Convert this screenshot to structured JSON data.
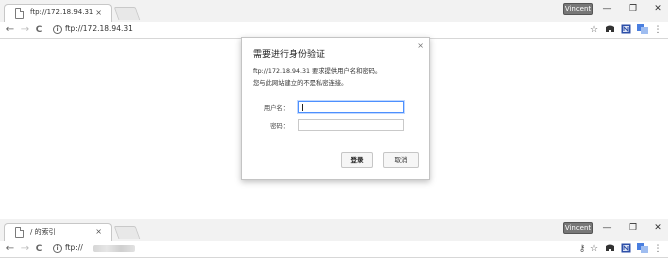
{
  "window1": {
    "tab_title": "ftp://172.18.94.31",
    "tab_close": "×",
    "username": "Vincent",
    "address_url": "ftp://172.18.94.31",
    "window_controls": {
      "minimize": "—",
      "maximize": "❐",
      "close": "✕"
    },
    "nav": {
      "back": "←",
      "forward": "→",
      "reload": "C"
    },
    "toolbar_icons": {
      "star": "☆",
      "more": "⋮"
    }
  },
  "dialog": {
    "close": "×",
    "title": "需要进行身份验证",
    "line1": "ftp://172.18.94.31 要求提供用户名和密码。",
    "line2": "您与此网站建立的不是私密连接。",
    "username_label": "用户名：",
    "password_label": "密码：",
    "username_value": "",
    "password_value": "",
    "login_button": "登录",
    "cancel_button": "取消"
  },
  "window2": {
    "tab_title": "/ 的索引",
    "tab_close": "×",
    "username": "Vincent",
    "address_prefix": "ftp://",
    "window_controls": {
      "minimize": "—",
      "maximize": "❐",
      "close": "✕"
    },
    "nav": {
      "back": "←",
      "forward": "→",
      "reload": "C"
    },
    "toolbar_icons": {
      "key": "⚷",
      "star": "☆",
      "more": "⋮"
    }
  },
  "colors": {
    "focus_blue": "#4d90fe",
    "tab_bg": "#ffffff",
    "strip_bg": "#f2f2f2"
  }
}
